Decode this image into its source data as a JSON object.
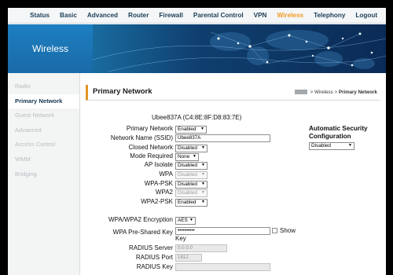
{
  "nav": {
    "items": [
      "Status",
      "Basic",
      "Advanced",
      "Router",
      "Firewall",
      "Parental Control",
      "VPN",
      "Wireless",
      "Telephony",
      "Logout"
    ],
    "active_index": 7,
    "active_color": "#f29b22"
  },
  "banner": {
    "title": "Wireless"
  },
  "sidebar": {
    "items": [
      "Radio",
      "Primary Network",
      "Guest Network",
      "Advanced",
      "Access Control",
      "WMM",
      "Bridging"
    ],
    "active_index": 1
  },
  "page": {
    "title": "Primary Network",
    "breadcrumb": {
      "section": "Wireless",
      "current": "Primary Network",
      "separator": ">"
    }
  },
  "form": {
    "mac_heading": "Ubee837A (C4:8E:8F:D8:83:7E)",
    "primary_network": {
      "label": "Primary Network",
      "value": "Enabled"
    },
    "ssid": {
      "label": "Network Name (SSID)",
      "value": "Ubee837A"
    },
    "closed_network": {
      "label": "Closed Network",
      "value": "Disabled"
    },
    "mode_required": {
      "label": "Mode Required",
      "value": "None"
    },
    "ap_isolate": {
      "label": "AP Isolate",
      "value": "Disabled"
    },
    "wpa": {
      "label": "WPA",
      "value": "Disabled"
    },
    "wpa_psk": {
      "label": "WPA-PSK",
      "value": "Disabled"
    },
    "wpa2": {
      "label": "WPA2",
      "value": "Disabled"
    },
    "wpa2_psk": {
      "label": "WPA2-PSK",
      "value": "Enabled"
    },
    "encryption": {
      "label": "WPA/WPA2 Encryption",
      "value": "AES"
    },
    "psk": {
      "label": "WPA Pre-Shared Key",
      "value": "••••••••••",
      "show_label": "Show",
      "key_suffix": "Key"
    },
    "radius_server": {
      "label": "RADIUS Server",
      "value": "0.0.0.0"
    },
    "radius_port": {
      "label": "RADIUS Port",
      "value": "1812"
    },
    "radius_key": {
      "label": "RADIUS Key",
      "value": ""
    }
  },
  "auto_security": {
    "title": "Automatic Security Configuration",
    "value": "Disabled"
  }
}
